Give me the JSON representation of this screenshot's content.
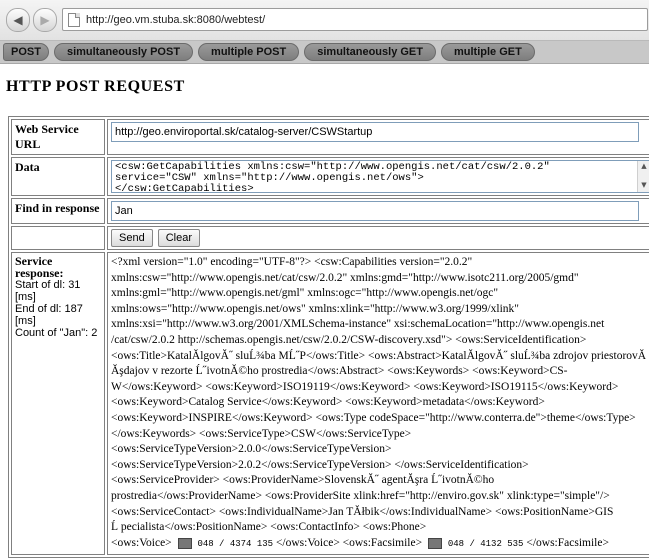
{
  "browser": {
    "url": "http://geo.vm.stuba.sk:8080/webtest/"
  },
  "tabs": [
    "POST",
    "simultaneously POST",
    "multiple POST",
    "simultaneously GET",
    "multiple GET"
  ],
  "heading": "HTTP POST REQUEST",
  "form": {
    "ws_label": "Web Service URL",
    "ws_value": "http://geo.enviroportal.sk/catalog-server/CSWStartup",
    "data_label": "Data",
    "data_lines": [
      "<csw:GetCapabilities xmlns:csw=\"http://www.opengis.net/cat/csw/2.0.2\"",
      "service=\"CSW\" xmlns=\"http://www.opengis.net/ows\">",
      "</csw:GetCapabilities>"
    ],
    "find_label": "Find in response",
    "find_value": "Jan",
    "send_label": "Send",
    "clear_label": "Clear"
  },
  "response": {
    "label": "Service response:",
    "start": "Start of dl: 31 [ms]",
    "end": "End of dl: 187 [ms]",
    "count": "Count of \"Jan\": 2",
    "lines": [
      "<?xml version=\"1.0\" encoding=\"UTF-8\"?> <csw:Capabilities version=\"2.0.2\"",
      "xmlns:csw=\"http://www.opengis.net/cat/csw/2.0.2\" xmlns:gmd=\"http://www.isotc211.org/2005/gmd\"",
      "xmlns:gml=\"http://www.opengis.net/gml\" xmlns:ogc=\"http://www.opengis.net/ogc\"",
      "xmlns:ows=\"http://www.opengis.net/ows\" xmlns:xlink=\"http://www.w3.org/1999/xlink\"",
      "xmlns:xsi=\"http://www.w3.org/2001/XMLSchema-instance\" xsi:schemaLocation=\"http://www.opengis.net",
      "/cat/csw/2.0.2 http://schemas.opengis.net/csw/2.0.2/CSW-discovery.xsd\"> <ows:ServiceIdentification>",
      "<ows:Title>KatalĂlgovĂ˝ sluĹ¾ba MĹ˝P</ows:Title> <ows:Abstract>KatalĂlgovĂ˝ sluĹ¾ba zdrojov priestorovĂ˝ch",
      "Ăşdajov v rezorte Ĺ˝ivotnĂ©ho prostredia</ows:Abstract> <ows:Keywords> <ows:Keyword>CS-",
      "W</ows:Keyword> <ows:Keyword>ISO19119</ows:Keyword> <ows:Keyword>ISO19115</ows:Keyword>",
      "<ows:Keyword>Catalog Service</ows:Keyword> <ows:Keyword>metadata</ows:Keyword>",
      "<ows:Keyword>INSPIRE</ows:Keyword> <ows:Type codeSpace=\"http://www.conterra.de\">theme</ows:Type>",
      "</ows:Keywords> <ows:ServiceType>CSW</ows:ServiceType>",
      "<ows:ServiceTypeVersion>2.0.0</ows:ServiceTypeVersion>",
      "<ows:ServiceTypeVersion>2.0.2</ows:ServiceTypeVersion> </ows:ServiceIdentification>",
      "<ows:ServiceProvider> <ows:ProviderName>SlovenskĂ˝ agentĂşra Ĺ˝ivotnĂ©ho",
      "prostredia</ows:ProviderName> <ows:ProviderSite xlink:href=\"http://enviro.gov.sk\" xlink:type=\"simple\"/>",
      "<ows:ServiceContact> <ows:IndividualName>Jan TĂłbik</ows:IndividualName> <ows:PositionName>GIS",
      "Ĺ pecialista</ows:PositionName> <ows:ContactInfo> <ows:Phone>"
    ],
    "last_line_parts": [
      "<ows:Voice>",
      "048 / 4374 135",
      "</ows:Voice> <ows:Facsimile>",
      "048 / 4132 535",
      "</ows:Facsimile>"
    ]
  }
}
